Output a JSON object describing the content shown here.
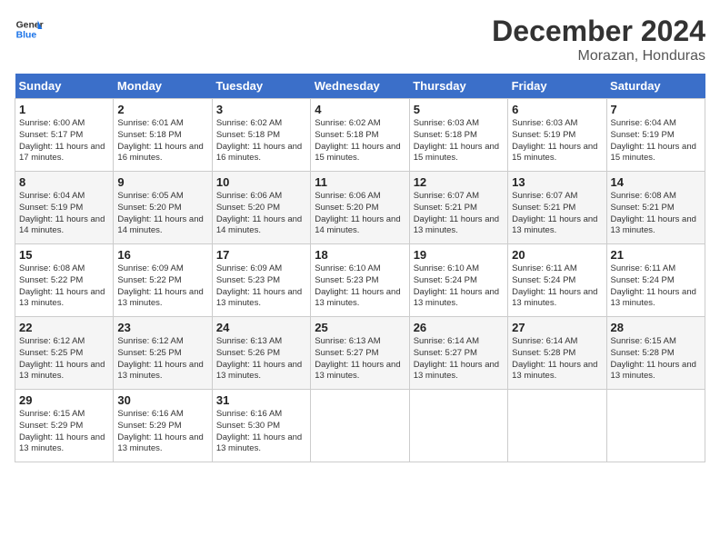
{
  "header": {
    "logo_line1": "General",
    "logo_line2": "Blue",
    "month_title": "December 2024",
    "location": "Morazan, Honduras"
  },
  "calendar": {
    "days_of_week": [
      "Sunday",
      "Monday",
      "Tuesday",
      "Wednesday",
      "Thursday",
      "Friday",
      "Saturday"
    ],
    "weeks": [
      [
        {
          "day": "1",
          "sunrise": "6:00 AM",
          "sunset": "5:17 PM",
          "daylight": "11 hours and 17 minutes."
        },
        {
          "day": "2",
          "sunrise": "6:01 AM",
          "sunset": "5:18 PM",
          "daylight": "11 hours and 16 minutes."
        },
        {
          "day": "3",
          "sunrise": "6:02 AM",
          "sunset": "5:18 PM",
          "daylight": "11 hours and 16 minutes."
        },
        {
          "day": "4",
          "sunrise": "6:02 AM",
          "sunset": "5:18 PM",
          "daylight": "11 hours and 15 minutes."
        },
        {
          "day": "5",
          "sunrise": "6:03 AM",
          "sunset": "5:18 PM",
          "daylight": "11 hours and 15 minutes."
        },
        {
          "day": "6",
          "sunrise": "6:03 AM",
          "sunset": "5:19 PM",
          "daylight": "11 hours and 15 minutes."
        },
        {
          "day": "7",
          "sunrise": "6:04 AM",
          "sunset": "5:19 PM",
          "daylight": "11 hours and 15 minutes."
        }
      ],
      [
        {
          "day": "8",
          "sunrise": "6:04 AM",
          "sunset": "5:19 PM",
          "daylight": "11 hours and 14 minutes."
        },
        {
          "day": "9",
          "sunrise": "6:05 AM",
          "sunset": "5:20 PM",
          "daylight": "11 hours and 14 minutes."
        },
        {
          "day": "10",
          "sunrise": "6:06 AM",
          "sunset": "5:20 PM",
          "daylight": "11 hours and 14 minutes."
        },
        {
          "day": "11",
          "sunrise": "6:06 AM",
          "sunset": "5:20 PM",
          "daylight": "11 hours and 14 minutes."
        },
        {
          "day": "12",
          "sunrise": "6:07 AM",
          "sunset": "5:21 PM",
          "daylight": "11 hours and 13 minutes."
        },
        {
          "day": "13",
          "sunrise": "6:07 AM",
          "sunset": "5:21 PM",
          "daylight": "11 hours and 13 minutes."
        },
        {
          "day": "14",
          "sunrise": "6:08 AM",
          "sunset": "5:21 PM",
          "daylight": "11 hours and 13 minutes."
        }
      ],
      [
        {
          "day": "15",
          "sunrise": "6:08 AM",
          "sunset": "5:22 PM",
          "daylight": "11 hours and 13 minutes."
        },
        {
          "day": "16",
          "sunrise": "6:09 AM",
          "sunset": "5:22 PM",
          "daylight": "11 hours and 13 minutes."
        },
        {
          "day": "17",
          "sunrise": "6:09 AM",
          "sunset": "5:23 PM",
          "daylight": "11 hours and 13 minutes."
        },
        {
          "day": "18",
          "sunrise": "6:10 AM",
          "sunset": "5:23 PM",
          "daylight": "11 hours and 13 minutes."
        },
        {
          "day": "19",
          "sunrise": "6:10 AM",
          "sunset": "5:24 PM",
          "daylight": "11 hours and 13 minutes."
        },
        {
          "day": "20",
          "sunrise": "6:11 AM",
          "sunset": "5:24 PM",
          "daylight": "11 hours and 13 minutes."
        },
        {
          "day": "21",
          "sunrise": "6:11 AM",
          "sunset": "5:24 PM",
          "daylight": "11 hours and 13 minutes."
        }
      ],
      [
        {
          "day": "22",
          "sunrise": "6:12 AM",
          "sunset": "5:25 PM",
          "daylight": "11 hours and 13 minutes."
        },
        {
          "day": "23",
          "sunrise": "6:12 AM",
          "sunset": "5:25 PM",
          "daylight": "11 hours and 13 minutes."
        },
        {
          "day": "24",
          "sunrise": "6:13 AM",
          "sunset": "5:26 PM",
          "daylight": "11 hours and 13 minutes."
        },
        {
          "day": "25",
          "sunrise": "6:13 AM",
          "sunset": "5:27 PM",
          "daylight": "11 hours and 13 minutes."
        },
        {
          "day": "26",
          "sunrise": "6:14 AM",
          "sunset": "5:27 PM",
          "daylight": "11 hours and 13 minutes."
        },
        {
          "day": "27",
          "sunrise": "6:14 AM",
          "sunset": "5:28 PM",
          "daylight": "11 hours and 13 minutes."
        },
        {
          "day": "28",
          "sunrise": "6:15 AM",
          "sunset": "5:28 PM",
          "daylight": "11 hours and 13 minutes."
        }
      ],
      [
        {
          "day": "29",
          "sunrise": "6:15 AM",
          "sunset": "5:29 PM",
          "daylight": "11 hours and 13 minutes."
        },
        {
          "day": "30",
          "sunrise": "6:16 AM",
          "sunset": "5:29 PM",
          "daylight": "11 hours and 13 minutes."
        },
        {
          "day": "31",
          "sunrise": "6:16 AM",
          "sunset": "5:30 PM",
          "daylight": "11 hours and 13 minutes."
        },
        null,
        null,
        null,
        null
      ]
    ]
  }
}
